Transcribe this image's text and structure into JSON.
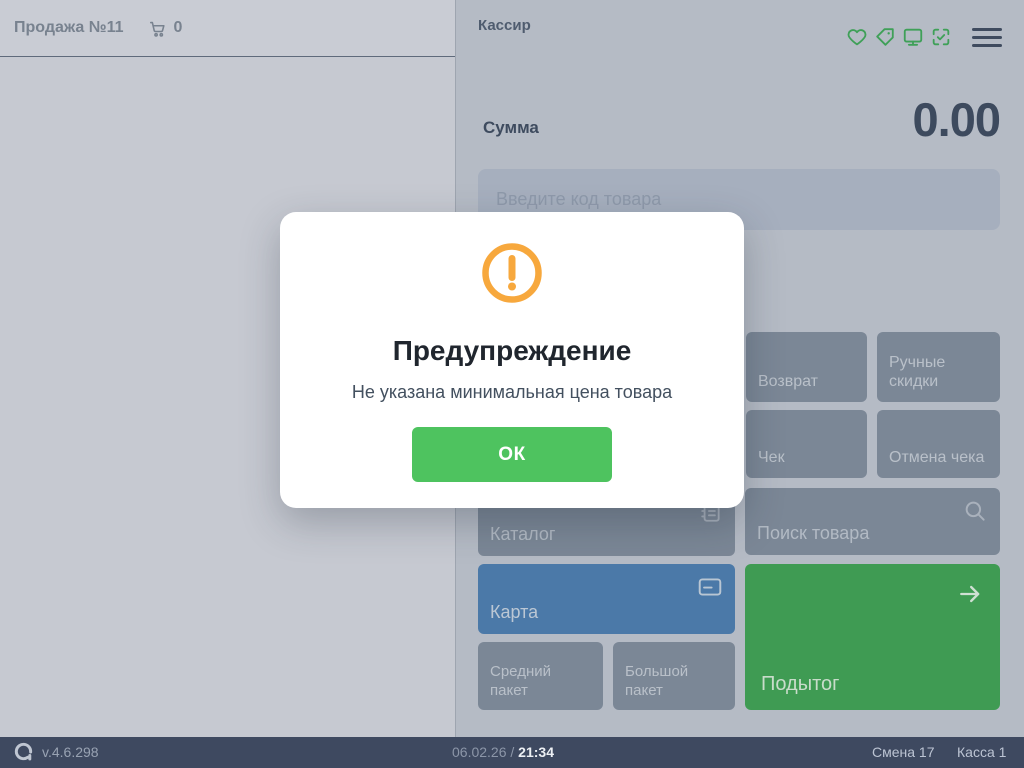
{
  "colors": {
    "accent_green": "#4ec35f",
    "warning_orange": "#f7a83d",
    "button_grey": "#7b8796",
    "card_blue": "#4b79a8",
    "subtotal_green": "#3f9b53",
    "statusbar_navy": "#3e4960"
  },
  "left_panel": {
    "title": "Продажа №11",
    "cart_count": "0"
  },
  "right_panel": {
    "cashier_label": "Кассир",
    "sum_label": "Сумма",
    "sum_value": "0.00",
    "input_placeholder": "Введите код товара",
    "buttons": {
      "refund": "Возврат",
      "manual_discounts": "Ручные скидки",
      "receipt": "Чек",
      "cancel_receipt": "Отмена чека",
      "catalog": "Каталог",
      "product_search": "Поиск товара",
      "card": "Карта",
      "subtotal": "Подытог",
      "medium_bag": "Средний пакет",
      "big_bag": "Большой пакет"
    }
  },
  "modal": {
    "title": "Предупреждение",
    "message": "Не указана минимальная цена товара",
    "ok_label": "ОК"
  },
  "status_bar": {
    "version": "v.4.6.298",
    "date": "06.02.26",
    "separator": "/",
    "time": "21:34",
    "shift": "Смена 17",
    "register": "Касса 1"
  }
}
